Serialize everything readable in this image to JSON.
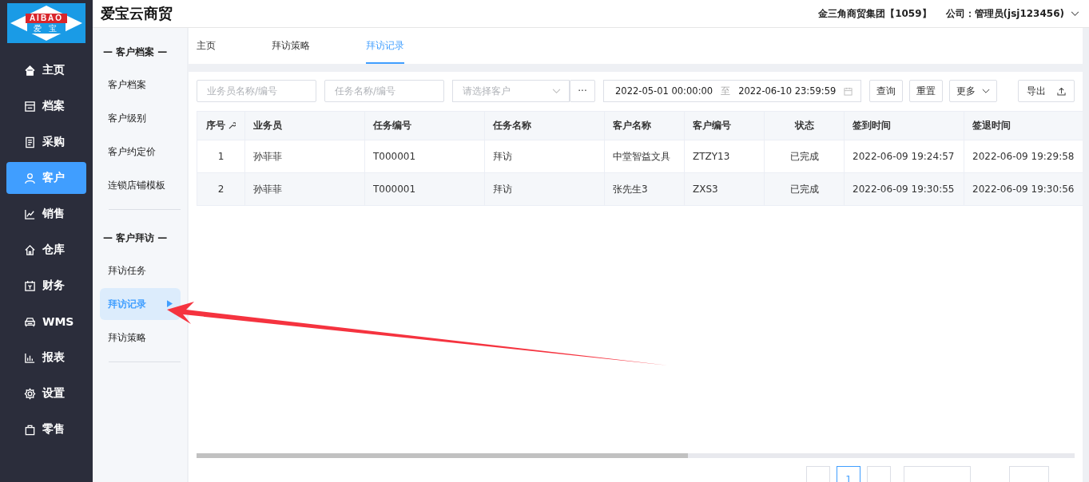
{
  "logo": {
    "top": "AIBAO",
    "bottom": "爱 宝"
  },
  "app_title": "爱宝云商贸",
  "header": {
    "company": "金三角商贸集团【1059】",
    "user": "公司：管理员(jsj123456)"
  },
  "nav": [
    {
      "label": "主页",
      "selected": false
    },
    {
      "label": "档案",
      "selected": false
    },
    {
      "label": "采购",
      "selected": false
    },
    {
      "label": "客户",
      "selected": true
    },
    {
      "label": "销售",
      "selected": false
    },
    {
      "label": "仓库",
      "selected": false
    },
    {
      "label": "财务",
      "selected": false
    },
    {
      "label": "WMS",
      "selected": false
    },
    {
      "label": "报表",
      "selected": false
    },
    {
      "label": "设置",
      "selected": false
    },
    {
      "label": "零售",
      "selected": false
    }
  ],
  "submenu": [
    {
      "title": "— 客户档案 —",
      "items": [
        {
          "label": "客户档案",
          "selected": false
        },
        {
          "label": "客户级别",
          "selected": false
        },
        {
          "label": "客户约定价",
          "selected": false
        },
        {
          "label": "连锁店铺模板",
          "selected": false
        }
      ]
    },
    {
      "title": "— 客户拜访 —",
      "items": [
        {
          "label": "拜访任务",
          "selected": false
        },
        {
          "label": "拜访记录",
          "selected": true
        },
        {
          "label": "拜访策略",
          "selected": false
        }
      ]
    }
  ],
  "tabs": [
    {
      "label": "主页",
      "selected": false
    },
    {
      "label": "拜访策略",
      "selected": false
    },
    {
      "label": "拜访记录",
      "selected": true
    }
  ],
  "filters": {
    "salesman_placeholder": "业务员名称/编号",
    "task_placeholder": "任务名称/编号",
    "customer_placeholder": "请选择客户",
    "more_picker": "···",
    "date_from": "2022-05-01 00:00:00",
    "date_sep": "至",
    "date_to": "2022-06-10 23:59:59",
    "buttons": [
      "查询",
      "重置"
    ],
    "more": "更多",
    "export": "导出"
  },
  "table": {
    "columns": [
      "序号",
      "业务员",
      "任务编号",
      "任务名称",
      "客户名称",
      "客户编号",
      "状态",
      "签到时间",
      "签退时间"
    ],
    "rows": [
      [
        "1",
        "孙菲菲",
        "T000001",
        "拜访",
        "中堂智益文具",
        "ZTZY13",
        "已完成",
        "2022-06-09 19:24:57",
        "2022-06-09 19:29:58"
      ],
      [
        "2",
        "孙菲菲",
        "T000001",
        "拜访",
        "张先生3",
        "ZXS3",
        "已完成",
        "2022-06-09 19:30:55",
        "2022-06-09 19:30:56"
      ]
    ]
  },
  "pagination": {
    "current_page": "1"
  }
}
